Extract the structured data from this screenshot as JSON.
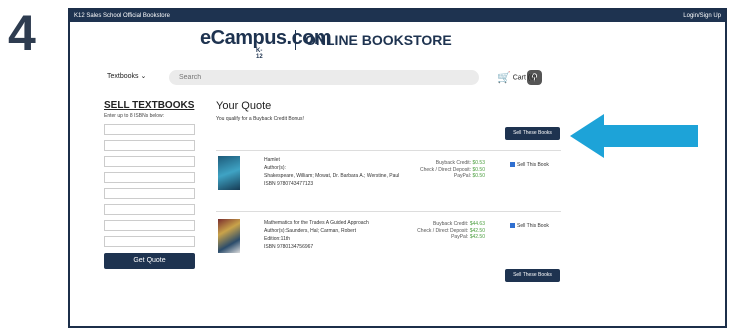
{
  "step": "4",
  "topbar": {
    "left": "K12 Sales School Official Bookstore",
    "right": "Login/Sign Up"
  },
  "logo": {
    "brand": "eCampus.com",
    "sub": "K-12",
    "store": "ONLINE BOOKSTORE"
  },
  "nav": {
    "dropdown": "Textbooks",
    "search_placeholder": "Search",
    "cart": "Cart (0)"
  },
  "sell": {
    "title": "SELL TEXTBOOKS",
    "subtitle": "Enter up to 8 ISBNs below:",
    "field_count": 8,
    "button": "Get Quote"
  },
  "quote": {
    "title": "Your Quote",
    "subtitle": "You qualify for a Buyback Credit Bonus!",
    "sell_button": "Sell These Books",
    "books": [
      {
        "title": "Hamlet",
        "author_label": "Author(s):",
        "authors": "Shakespeare, William; Mowat, Dr. Barbara A.; Werstine, Paul",
        "isbn": "ISBN 9780743477123",
        "labels": [
          "Buyback Credit:",
          "Check / Direct Deposit:",
          "PayPal:"
        ],
        "values": [
          "$0.53",
          "$0.50",
          "$0.50"
        ],
        "sell_label": "Sell This Book"
      },
      {
        "title": "Mathematics for the Trades A Guided Approach",
        "author_label": "Author(s):",
        "authors": "Saunders, Hal; Carman, Robert",
        "edition": "Edition:11th",
        "isbn": "ISBN 9780134756967",
        "labels": [
          "Buyback Credit:",
          "Check / Direct Deposit:",
          "PayPal:"
        ],
        "values": [
          "$44.63",
          "$42.50",
          "$42.50"
        ],
        "sell_label": "Sell This Book"
      }
    ]
  },
  "colors": {
    "navy": "#1e3350",
    "arrow": "#1da3d8",
    "price_green": "#4a9e3e"
  },
  "icons": [
    "chevron-down-icon",
    "search-icon",
    "cart-icon",
    "checkbox-icon",
    "arrow-left-icon"
  ]
}
